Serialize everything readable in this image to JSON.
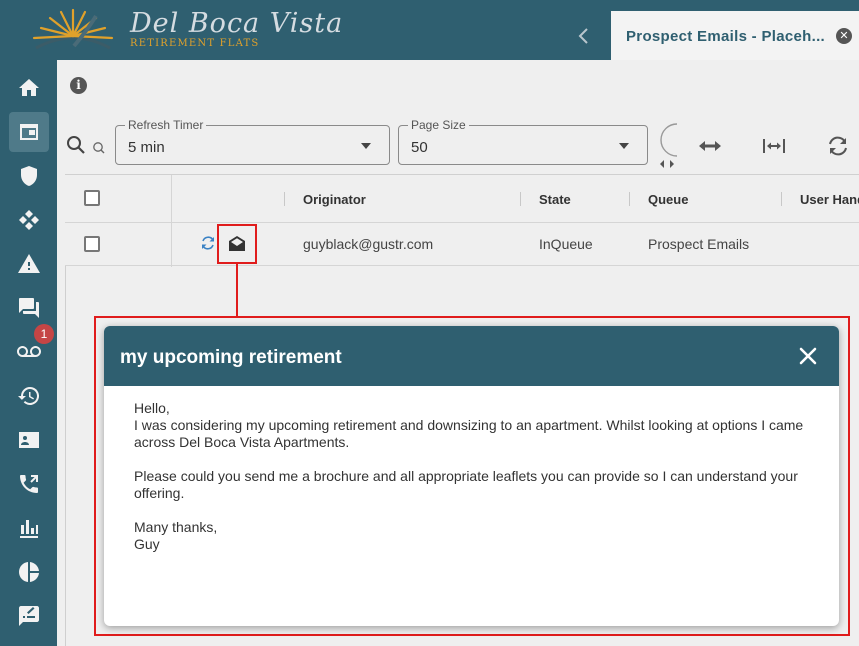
{
  "brand": {
    "name": "Del Boca Vista",
    "tagline": "RETIREMENT FLATS"
  },
  "tab": {
    "label": "Prospect Emails - Placeh..."
  },
  "sidebar": {
    "voicemail_badge": "1"
  },
  "toolbar": {
    "refresh_timer": {
      "label": "Refresh Timer",
      "value": "5 min"
    },
    "page_size": {
      "label": "Page Size",
      "value": "50"
    }
  },
  "table": {
    "columns": [
      "Originator",
      "State",
      "Queue",
      "User Hand"
    ],
    "rows": [
      {
        "originator": "guyblack@gustr.com",
        "state": "InQueue",
        "queue": "Prospect Emails"
      }
    ]
  },
  "dialog": {
    "title": "my upcoming retirement",
    "greeting": "Hello,",
    "paragraph1": "I was considering my upcoming retirement and downsizing to an apartment. Whilst looking at options I came across Del Boca Vista Apartments.",
    "paragraph2": "Please could you send me a brochure and all appropriate leaflets you can provide so I can understand your offering.",
    "signoff": "Many thanks,",
    "signature": "Guy"
  },
  "colors": {
    "primary": "#2f5f70",
    "accent": "#e0a12b",
    "highlight": "#e01c1c",
    "badge": "#c54545"
  }
}
